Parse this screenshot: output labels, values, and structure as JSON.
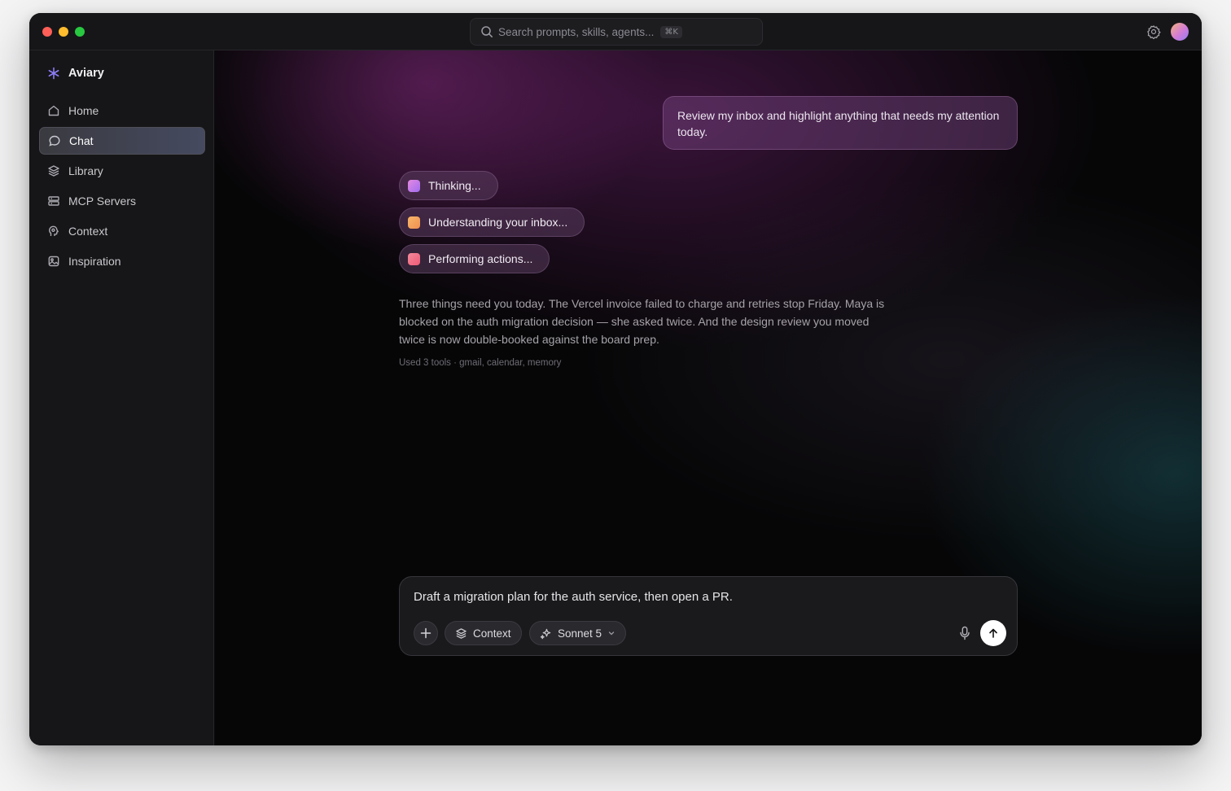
{
  "window": {
    "traffic_colors": [
      "#ff5f57",
      "#febc2e",
      "#28c840"
    ]
  },
  "search": {
    "placeholder": "Search prompts, skills, agents...",
    "shortcut": "⌘K"
  },
  "brand": {
    "name": "Aviary",
    "icon": "asterisk-icon",
    "accent": "#8b7cf6"
  },
  "sidebar": {
    "items": [
      {
        "label": "Home",
        "icon": "home-icon",
        "active": false
      },
      {
        "label": "Chat",
        "icon": "chat-bubble-icon",
        "active": true
      },
      {
        "label": "Library",
        "icon": "layers-icon",
        "active": false
      },
      {
        "label": "MCP Servers",
        "icon": "server-icon",
        "active": false
      },
      {
        "label": "Context",
        "icon": "head-icon",
        "active": false
      },
      {
        "label": "Inspiration",
        "icon": "image-icon",
        "active": false
      }
    ]
  },
  "chat": {
    "user_message": "Review my inbox and highlight anything that needs my attention today.",
    "steps": [
      {
        "label": "Thinking...",
        "color": "#d07ae8"
      },
      {
        "label": "Understanding your inbox...",
        "color": "#f4a262"
      },
      {
        "label": "Performing actions...",
        "color": "#f26e86"
      }
    ],
    "answer": "Three things need you today. The Vercel invoice failed to charge and retries stop Friday. Maya is blocked on the auth migration decision — she asked twice. And the design review you moved twice is now double-booked against the board prep.",
    "meta": "Used 3 tools · gmail, calendar, memory"
  },
  "composer": {
    "text": "Draft a migration plan for the auth service, then open a PR.",
    "context_label": "Context",
    "model_label": "Sonnet 5"
  }
}
